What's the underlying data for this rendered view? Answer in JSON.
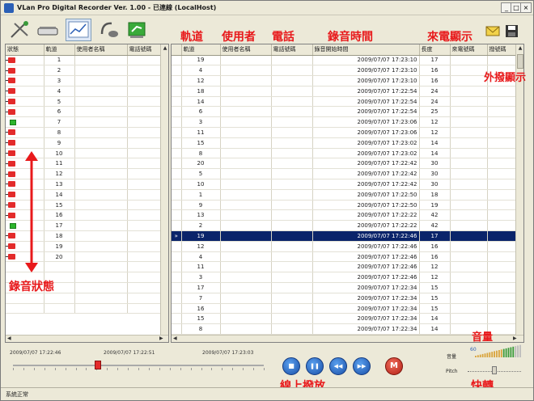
{
  "window": {
    "title": "VLan Pro Digital Recorder Ver. 1.00 - 已連線 (LocalHost)",
    "controls": {
      "minimize": "_",
      "maximize": "□",
      "close": "×"
    }
  },
  "toolbar": {
    "buttons": [
      {
        "icon": "phone-line-icon"
      },
      {
        "icon": "scanner-icon"
      },
      {
        "icon": "chart-icon",
        "active": true
      },
      {
        "icon": "headset-icon"
      },
      {
        "icon": "green-screen-icon"
      }
    ],
    "right_buttons": [
      {
        "icon": "mail-icon"
      },
      {
        "icon": "save-icon"
      }
    ]
  },
  "annotations": {
    "track": "軌道",
    "user": "使用者",
    "phone": "電話",
    "record_time": "錄音時間",
    "caller_id": "來電顯示",
    "outgoing": "外撥顯示",
    "record_status": "錄音狀態",
    "playback": "線上撥放",
    "volume": "音量",
    "fast_forward": "快轉"
  },
  "left_table": {
    "headers": [
      "狀態",
      "軌道",
      "使用者名稱",
      "電話號碼"
    ],
    "rows": [
      {
        "track": "1",
        "status": "rec"
      },
      {
        "track": "2",
        "status": "rec"
      },
      {
        "track": "3",
        "status": "rec"
      },
      {
        "track": "4",
        "status": "rec"
      },
      {
        "track": "5",
        "status": "rec"
      },
      {
        "track": "6",
        "status": "rec"
      },
      {
        "track": "7",
        "status": "idle"
      },
      {
        "track": "8",
        "status": "rec"
      },
      {
        "track": "9",
        "status": "rec"
      },
      {
        "track": "10",
        "status": "rec"
      },
      {
        "track": "11",
        "status": "rec"
      },
      {
        "track": "12",
        "status": "rec"
      },
      {
        "track": "13",
        "status": "rec"
      },
      {
        "track": "14",
        "status": "rec"
      },
      {
        "track": "15",
        "status": "rec"
      },
      {
        "track": "16",
        "status": "rec"
      },
      {
        "track": "17",
        "status": "idle"
      },
      {
        "track": "18",
        "status": "rec"
      },
      {
        "track": "19",
        "status": "rec"
      },
      {
        "track": "20",
        "status": "rec"
      }
    ]
  },
  "right_table": {
    "headers": [
      "",
      "軌道",
      "使用者名稱",
      "電話號碼",
      "錄音開始時間",
      "長度",
      "來電號碼",
      "撥號碼"
    ],
    "rows": [
      {
        "track": "19",
        "time": "2009/07/07 17:23:10",
        "len": "17"
      },
      {
        "track": "4",
        "time": "2009/07/07 17:23:10",
        "len": "16"
      },
      {
        "track": "12",
        "time": "2009/07/07 17:23:10",
        "len": "16"
      },
      {
        "track": "18",
        "time": "2009/07/07 17:22:54",
        "len": "24"
      },
      {
        "track": "14",
        "time": "2009/07/07 17:22:54",
        "len": "24"
      },
      {
        "track": "6",
        "time": "2009/07/07 17:22:54",
        "len": "25"
      },
      {
        "track": "3",
        "time": "2009/07/07 17:23:06",
        "len": "12"
      },
      {
        "track": "11",
        "time": "2009/07/07 17:23:06",
        "len": "12"
      },
      {
        "track": "15",
        "time": "2009/07/07 17:23:02",
        "len": "14"
      },
      {
        "track": "8",
        "time": "2009/07/07 17:23:02",
        "len": "14"
      },
      {
        "track": "20",
        "time": "2009/07/07 17:22:42",
        "len": "30"
      },
      {
        "track": "5",
        "time": "2009/07/07 17:22:42",
        "len": "30"
      },
      {
        "track": "10",
        "time": "2009/07/07 17:22:42",
        "len": "30"
      },
      {
        "track": "1",
        "time": "2009/07/07 17:22:50",
        "len": "18"
      },
      {
        "track": "9",
        "time": "2009/07/07 17:22:50",
        "len": "19"
      },
      {
        "track": "13",
        "time": "2009/07/07 17:22:22",
        "len": "42"
      },
      {
        "track": "2",
        "time": "2009/07/07 17:22:22",
        "len": "42"
      },
      {
        "track": "19",
        "time": "2009/07/07 17:22:46",
        "len": "17",
        "selected": true,
        "marker": "»"
      },
      {
        "track": "12",
        "time": "2009/07/07 17:22:46",
        "len": "16"
      },
      {
        "track": "4",
        "time": "2009/07/07 17:22:46",
        "len": "16"
      },
      {
        "track": "11",
        "time": "2009/07/07 17:22:46",
        "len": "12"
      },
      {
        "track": "3",
        "time": "2009/07/07 17:22:46",
        "len": "12"
      },
      {
        "track": "17",
        "time": "2009/07/07 17:22:34",
        "len": "15"
      },
      {
        "track": "7",
        "time": "2009/07/07 17:22:34",
        "len": "15"
      },
      {
        "track": "16",
        "time": "2009/07/07 17:22:34",
        "len": "15"
      },
      {
        "track": "15",
        "time": "2009/07/07 17:22:34",
        "len": "14"
      },
      {
        "track": "8",
        "time": "2009/07/07 17:22:34",
        "len": "14"
      }
    ]
  },
  "timeline": {
    "start": "2009/07/07 17:22:46",
    "mid": "2009/07/07 17:22:51",
    "end": "2009/07/07 17:23:03",
    "position": 0.34
  },
  "playback_buttons": [
    {
      "icon": "stop-icon",
      "glyph": "■"
    },
    {
      "icon": "pause-icon",
      "glyph": "❚❚"
    },
    {
      "icon": "rewind-icon",
      "glyph": "◀◀"
    },
    {
      "icon": "forward-icon",
      "glyph": "▶▶"
    }
  ],
  "mp_button": {
    "icon": "mp-logo-icon",
    "glyph": "M"
  },
  "volume": {
    "label": "音量",
    "value": "60",
    "level": 0.6
  },
  "pitch": {
    "label": "Pitch",
    "level": 0.5
  },
  "status": "系統正常",
  "colors": {
    "annotation": "#e8191b",
    "selection": "#0a246a",
    "record": "#e32b2b",
    "idle": "#2db52d"
  }
}
